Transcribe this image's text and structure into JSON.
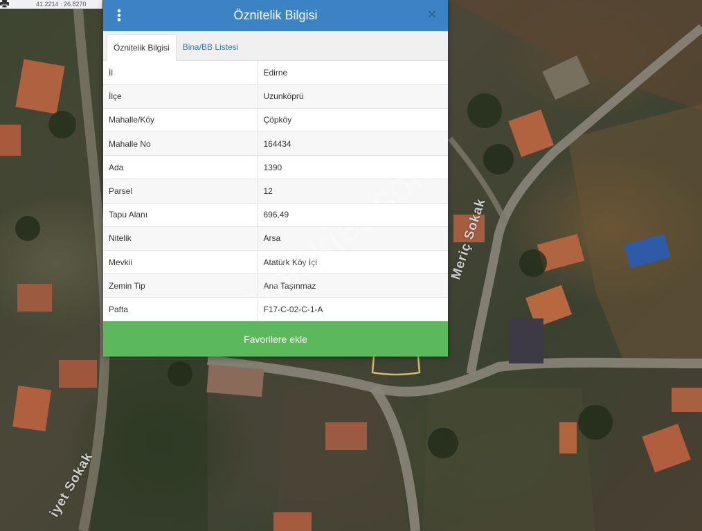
{
  "map": {
    "coordinates": "41.2214 : 26.8270",
    "street_labels": [
      "Meriç Sokak",
      "iyet Sokak"
    ]
  },
  "dialog": {
    "title": "Öznitelik Bilgisi",
    "tabs": [
      {
        "label": "Öznitelik Bilgisi",
        "active": true
      },
      {
        "label": "Bina/BB Listesi",
        "active": false
      }
    ],
    "rows": [
      {
        "key": "İl",
        "value": "Edirne"
      },
      {
        "key": "İlçe",
        "value": "Uzunköprü"
      },
      {
        "key": "Mahalle/Köy",
        "value": "Çöpköy"
      },
      {
        "key": "Mahalle No",
        "value": "164434"
      },
      {
        "key": "Ada",
        "value": "1390"
      },
      {
        "key": "Parsel",
        "value": "12"
      },
      {
        "key": "Tapu Alanı",
        "value": "696,49"
      },
      {
        "key": "Nitelik",
        "value": "Arsa"
      },
      {
        "key": "Mevkii",
        "value": "Atatürk Köy İçi"
      },
      {
        "key": "Zemin Tip",
        "value": "Ana Taşınmaz"
      },
      {
        "key": "Pafta",
        "value": "F17-C-02-C-1-A"
      }
    ],
    "favorite_button_label": "Favorilere ekle"
  },
  "watermark": "emlakjet.com",
  "colors": {
    "header_blue": "#3b83c4",
    "button_green": "#5cb85c",
    "tab_link_blue": "#337ab7"
  }
}
